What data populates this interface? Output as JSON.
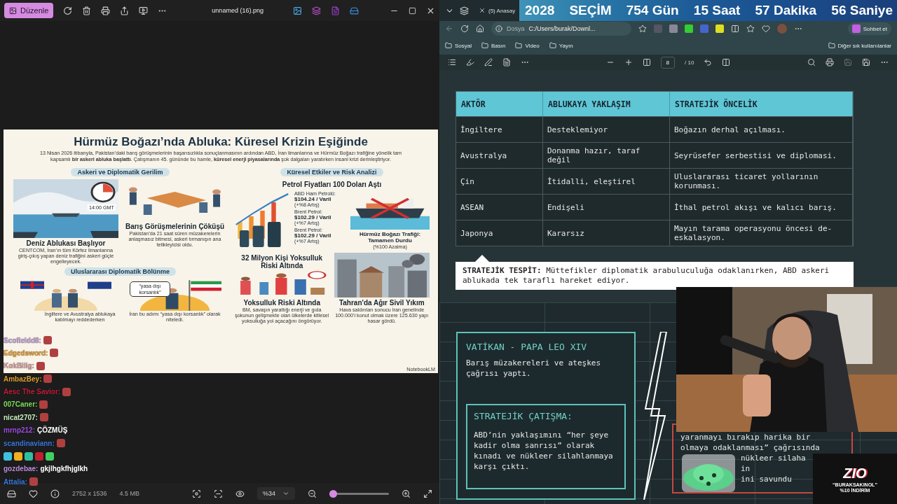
{
  "viewer": {
    "edit_button": "Düzenle",
    "file_name": "unnamed (16).png",
    "dimensions": "2752 x 1536",
    "file_size": "4.5 MB",
    "zoom": "%34",
    "zoom_slider": {
      "level": 0.06
    }
  },
  "infographic": {
    "title": "Hürmüz Boğazı’nda Abluka: Küresel Krizin Eşiğinde",
    "intro": "13 Nisan 2026 itibarıyla, Pakistan’daki barış görüşmelerinin başarısızlıkla sonuçlanmasının ardından ABD, İran limanlarına ve Hürmüz Boğazı trafiğine yönelik tam kapsamlı **bir askeri abluka başlattı**. Çatışmanın 45. gününde bu hamle, **küresel enerji piyasalarında** şok dalgaları yaratırken insani krizi derinleştiriyor.",
    "sections": [
      {
        "heading": "Askeri ve Diplomatik Gerilim",
        "cards": [
          {
            "kind": "blockade",
            "badge": "14:00 GMT",
            "title": "Deniz Ablukası Başlıyor",
            "text": "CENTCOM, İran’ın tüm Körfez limanlarına giriş-çıkış yapan deniz trafiğini askeri güçle engelleyecek."
          },
          {
            "kind": "talks",
            "title": "Barış Görüşmelerinin Çöküşü",
            "text": "Pakistan’da 21 saat süren müzakerelerin anlaşmasız bitmesi, askeri tırmanışın ana tetikleyicisi oldu."
          }
        ]
      },
      {
        "heading": "Uluslararası Diplomatik Bölünme",
        "cards": [
          {
            "kind": "allies",
            "text": "İngiltere ve Avustralya ablukaya katılmayı reddederken"
          },
          {
            "kind": "iran",
            "bubble": "“yasa dışı korsanlık”",
            "text": "İran bu adımı “yasa dışı korsanlık” olarak niteledi."
          }
        ]
      }
    ],
    "impact": {
      "heading": "Küresel Etkiler ve Risk Analizi",
      "title": "Petrol Fiyatları 100 Doları Aştı",
      "prices": [
        {
          "name": "ABD Ham Petrolü:",
          "price": "$104.24 / Varil",
          "change": "(+%8 Artış)"
        },
        {
          "name": "Brent Petrol:",
          "price": "$102.29 / Varil",
          "change": "(+%7 Artış)"
        },
        {
          "name": "Brent Petrol:",
          "price": "$102.29 / Varil",
          "change": "(+%7 Artış)"
        }
      ],
      "traffic": {
        "title": "Hürmüz Boğazı Trafiği: Tamamen Durdu",
        "change": "(%100 Azalma)"
      },
      "cards": [
        {
          "kind": "poverty",
          "headline": "32 Milyon Kişi Yoksulluk Riski Altında",
          "title": "Yoksulluk Riski Altında",
          "text": "BM, savaşın yarattığı enerji ve gıda şokunun gelişmekte olan ülkelerde kitlesel yoksulluğa yol açacağını öngörüyor."
        },
        {
          "kind": "city",
          "title": "Tahran'da Ağır Sivil Yıkım",
          "text": "Hava saldırıları sonucu İran genelinde 100.000'i konut olmak üzere 125.630 yapı hasar gördü."
        }
      ]
    },
    "footer": "NotebookLM"
  },
  "chat": [
    {
      "kind": "message",
      "user": "Scofieldd8:",
      "color": "#c8a6da",
      "emote": true
    },
    {
      "kind": "message",
      "user": "Edgedsword:",
      "color": "#e8a030",
      "emote": true
    },
    {
      "kind": "message",
      "user": "KokBilig:",
      "color": "#d9a0a0",
      "emote": true
    },
    {
      "kind": "message",
      "user": "AmbazBey:",
      "color": "#e0a030",
      "emote": true
    },
    {
      "kind": "message",
      "user": "Aesc The Savior:",
      "color": "#c0203a",
      "emote": true
    },
    {
      "kind": "message",
      "user": "007Caner:",
      "color": "#7de05a",
      "emote": true
    },
    {
      "kind": "message",
      "user": "nicat2707:",
      "color": "#c8f0c0",
      "emote": true
    },
    {
      "kind": "message",
      "user": "mrnp212:",
      "color": "#a050e0",
      "message": "ÇÖZMÜŞ",
      "emote": false
    },
    {
      "kind": "message",
      "user": "scandinaviann:",
      "color": "#3a7ae0",
      "emote": true
    },
    {
      "kind": "badges"
    },
    {
      "kind": "message",
      "user": "gozdebae:",
      "color": "#c090e0",
      "message": "gkjlhgkfhjglkh",
      "emote": false
    },
    {
      "kind": "message",
      "user": "Attalia:",
      "color": "#3a7ae0",
      "emote": true
    }
  ],
  "browser": {
    "tabs": [
      {
        "label": "(5) Anasay",
        "selected": false
      }
    ],
    "countdown": [
      "2028",
      "SEÇİM",
      "754 Gün",
      "15 Saat",
      "57 Dakika",
      "56 Saniye"
    ],
    "address": {
      "scheme": "Dosya",
      "url": "C:/Users/burak/Downl..."
    },
    "copilot": "Sohbet et",
    "bookmarks": [
      "Sosyal",
      "Basın",
      "Video",
      "Yayın"
    ],
    "other_bookmarks": "Diğer sık kullanılanlar",
    "pdf_toolbar": {
      "page": "8",
      "page_count": "/ 10"
    }
  },
  "pdf": {
    "table": {
      "columns": [
        "AKTÖR",
        "ABLUKAYA YAKLAŞIM",
        "STRATEJİK ÖNCELİK"
      ],
      "rows": [
        [
          "İngiltere",
          "Desteklemiyor",
          "Boğazın derhal açılması."
        ],
        [
          "Avustralya",
          "Donanma hazır, taraf değil",
          "Seyrüsefer serbestisi ve diplomasi."
        ],
        [
          "Çin",
          "İtidalli, eleştirel",
          "Uluslararası ticaret yollarının korunması."
        ],
        [
          "ASEAN",
          "Endişeli",
          "İthal petrol akışı ve kalıcı barış."
        ],
        [
          "Japonya",
          "Kararsız",
          "Mayın tarama operasyonu öncesi de-eskalasyon."
        ]
      ]
    },
    "finding": {
      "label": "STRATEJİK TESPİT:",
      "text": "Müttefikler diplomatik arabuluculuğa odaklanırken, ABD askeri ablukada tek taraflı hareket ediyor."
    },
    "vatican_card": {
      "title": "VATİKAN - PAPA LEO XIV",
      "text": "Barış müzakereleri ve ateşkes çağrısı yaptı.",
      "conflict": {
        "title": "STRATEJİK ÇATIŞMA:",
        "text": "ABD’nin yaklaşımını “her şeye kadir olma sanrısı” olarak kınadı ve nükleer silahlanmaya karşı çıktı."
      }
    },
    "red_card": {
      "lines": [
        "yaranmayı bırakıp harika bir",
        "olmaya odaklanması” çağrısında"
      ],
      "tail_lines": [
        "nükleer silaha",
        "in",
        "ini savundu"
      ]
    }
  },
  "sponsor": {
    "logo": "ZIO",
    "code": "“BURAKSAKINOL”",
    "offer": "%10 İNDİRİM"
  }
}
